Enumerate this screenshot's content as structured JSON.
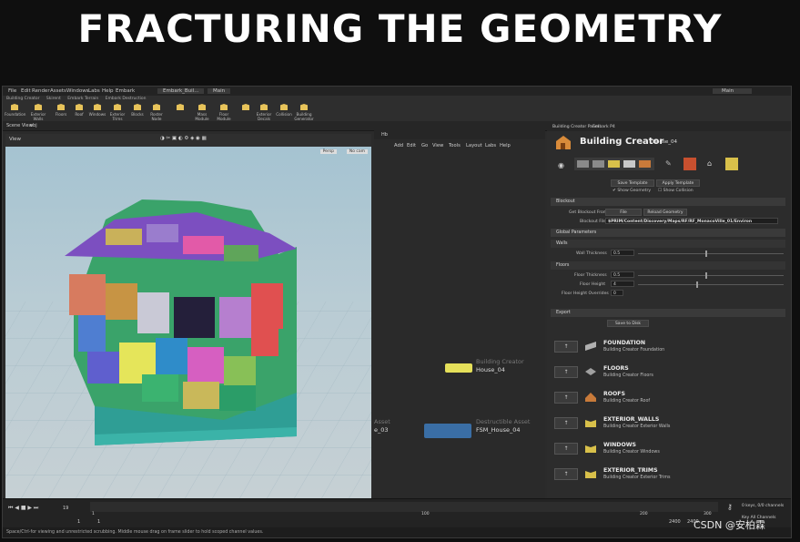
{
  "headline": "FRACTURING THE GEOMETRY",
  "menu": [
    "File",
    "Edit",
    "Render",
    "Assets",
    "Windows",
    "Labs",
    "Help",
    "Embark"
  ],
  "top_tabs": {
    "tab1": "Embark_Buil...",
    "tab2": "Main",
    "desktop": "Main"
  },
  "shelf_tabs": [
    "Building Creator",
    "Skirent",
    "Embark Terrain",
    "Embark Destruction"
  ],
  "shelf_tools": [
    "Foundation",
    "Exterior Walls",
    "Floors",
    "Roof",
    "Windows",
    "Exterior Trims",
    "Blocks",
    "Roster Node",
    "",
    "Mass Module",
    "Floor Module",
    "",
    "Exterior Decals",
    "Collision",
    "Building Generator"
  ],
  "scene_view_tab": "Scene View",
  "path_obj": "obj",
  "viewport": {
    "label": "View",
    "cam_left": "Persp",
    "cam_right": "No cam"
  },
  "network": {
    "tab": "Hb",
    "menu": [
      "Add",
      "Edit",
      "Go",
      "View",
      "Tools",
      "Layout",
      "Labs",
      "Help"
    ],
    "node1_type": "Building Creator",
    "node1_name": "House_04",
    "node2_type": "Destructible Asset",
    "node2_name": "FSM_House_04",
    "left_asset": "Asset",
    "left_name": "e_03"
  },
  "params": {
    "tab1": "Building Creator Panel",
    "tab2": "Embark P4",
    "title": "Building Creator",
    "title_sub": "House_04",
    "save_template": "Save Template",
    "apply_template": "Apply Template",
    "show_geometry": "Show Geometry",
    "show_collision": "Show Collision",
    "blockout_section": "Blockout",
    "get_blockout_label": "Get Blockout From",
    "get_blockout_value": "File",
    "reload_btn": "Reload Geometry",
    "blockout_file_label": "Blockout File",
    "blockout_file_value": "$PRIM/Content/Discovery/Maps/RF/RF_MonacoVille_01/Environ",
    "global_section": "Global Parameters",
    "walls_section": "Walls",
    "wall_thickness_label": "Wall Thickness",
    "wall_thickness": "0.5",
    "floors_section": "Floors",
    "floor_thickness_label": "Floor Thickness",
    "floor_thickness": "0.5",
    "floor_height_label": "Floor Height",
    "floor_height": "4",
    "floor_override_label": "Floor Height Overrides",
    "floor_override": "0",
    "export_section": "Export",
    "save_disk": "Save to Disk"
  },
  "modules": [
    {
      "name": "FOUNDATION",
      "desc": "Building Creator Foundation",
      "icon": "foundation-icon",
      "color": "#b0b0b0"
    },
    {
      "name": "FLOORS",
      "desc": "Building Creator Floors",
      "icon": "floors-icon",
      "color": "#a0a0a0"
    },
    {
      "name": "ROOFS",
      "desc": "Building Creator Roof",
      "icon": "roof-icon",
      "color": "#c87a3a"
    },
    {
      "name": "EXTERIOR_WALLS",
      "desc": "Building Creator Exterior Walls",
      "icon": "walls-icon",
      "color": "#d8c04a"
    },
    {
      "name": "WINDOWS",
      "desc": "Building Creator Windows",
      "icon": "windows-icon",
      "color": "#d8c04a"
    },
    {
      "name": "EXTERIOR_TRIMS",
      "desc": "Building Creator Exterior Trims",
      "icon": "trims-icon",
      "color": "#d8c04a"
    }
  ],
  "timeline": {
    "frame": "19",
    "start": "1",
    "end": "1",
    "ticks": [
      "1",
      "",
      "100",
      "",
      "200",
      "",
      "300"
    ],
    "end_a": "2400",
    "end_b": "2400",
    "keys": "0 keys, 0/0 channels",
    "channels": "Key All Channels"
  },
  "status": "Space/Ctrl-for viewing and unrestricted scrubbing. Middle mouse drag on frame slider to hold scoped channel values.",
  "watermark": "CSDN @安柏霖"
}
